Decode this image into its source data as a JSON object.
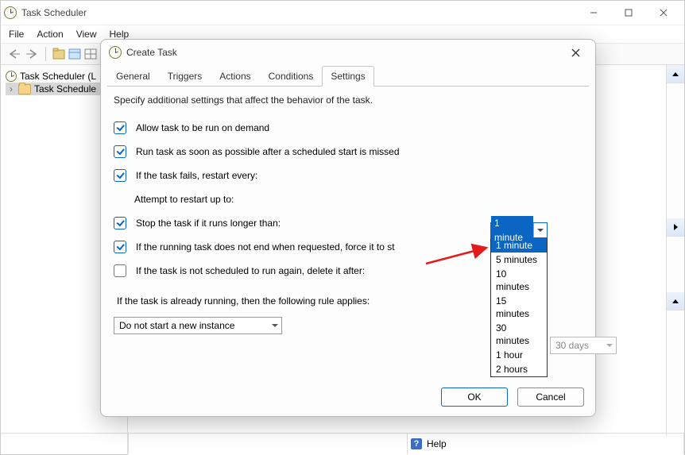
{
  "app": {
    "title": "Task Scheduler"
  },
  "menu": {
    "file": "File",
    "action": "Action",
    "view": "View",
    "help": "Help"
  },
  "tree": {
    "root": "Task Scheduler (L",
    "child": "Task Schedule"
  },
  "dialog": {
    "title": "Create Task",
    "tabs": {
      "general": "General",
      "triggers": "Triggers",
      "actions": "Actions",
      "conditions": "Conditions",
      "settings": "Settings"
    },
    "desc": "Specify additional settings that affect the behavior of the task.",
    "allow_demand": "Allow task to be run on demand",
    "run_asap": "Run task as soon as possible after a scheduled start is missed",
    "fail_restart": "If the task fails, restart every:",
    "attempt_label": "Attempt to restart up to:",
    "stop_longer": "Stop the task if it runs longer than:",
    "force_stop": "If the running task does not end when requested, force it to st",
    "delete_after": "If the task is not scheduled to run again, delete it after:",
    "rule_label": "If the task is already running, then the following rule applies:",
    "instance_rule": "Do not start a new instance",
    "delete_days": "30 days",
    "ok": "OK",
    "cancel": "Cancel"
  },
  "combo": {
    "selected": "1 minute",
    "options": [
      "1 minute",
      "5 minutes",
      "10 minutes",
      "15 minutes",
      "30 minutes",
      "1 hour",
      "2 hours"
    ]
  },
  "bottom": {
    "help": "Help"
  }
}
